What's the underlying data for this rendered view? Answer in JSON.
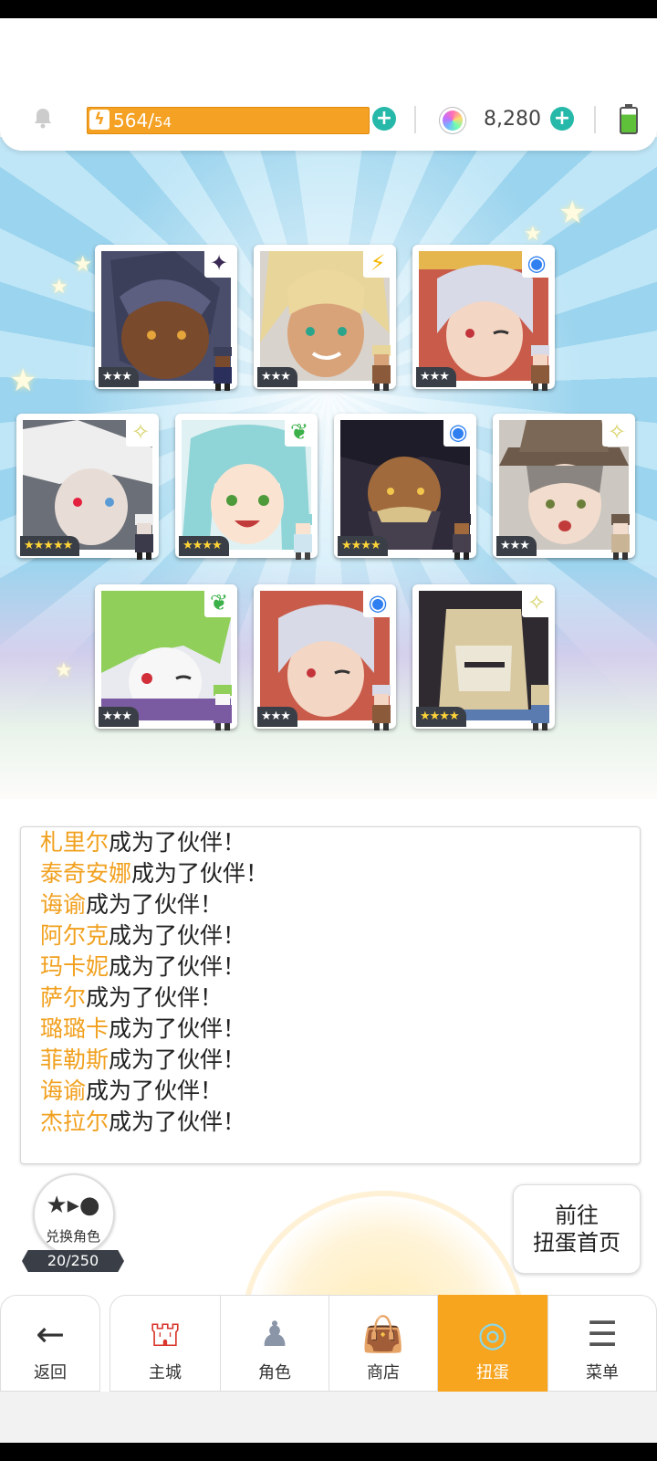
{
  "status": {
    "energy_current": "564",
    "energy_max": "54",
    "gems": "8,280"
  },
  "cards": [
    {
      "element": "dark",
      "element_icon": "✦",
      "element_color": "#3a2a55",
      "rarity": "★★★",
      "gold": false
    },
    {
      "element": "thunder",
      "element_icon": "⚡",
      "element_color": "#f5b800",
      "rarity": "★★★",
      "gold": false
    },
    {
      "element": "water",
      "element_icon": "◉",
      "element_color": "#2f7ff0",
      "rarity": "★★★",
      "gold": false
    },
    {
      "element": "light",
      "element_icon": "✧",
      "element_color": "#d7d36a",
      "rarity": "★★★★★",
      "gold": true
    },
    {
      "element": "earth",
      "element_icon": "❦",
      "element_color": "#3cb14a",
      "rarity": "★★★★",
      "gold": true
    },
    {
      "element": "water",
      "element_icon": "◉",
      "element_color": "#2f7ff0",
      "rarity": "★★★★",
      "gold": true
    },
    {
      "element": "light",
      "element_icon": "✧",
      "element_color": "#d7d36a",
      "rarity": "★★★",
      "gold": false
    },
    {
      "element": "earth",
      "element_icon": "❦",
      "element_color": "#3cb14a",
      "rarity": "★★★",
      "gold": false
    },
    {
      "element": "water",
      "element_icon": "◉",
      "element_color": "#2f7ff0",
      "rarity": "★★★",
      "gold": false
    },
    {
      "element": "light",
      "element_icon": "✧",
      "element_color": "#d7d36a",
      "rarity": "★★★★",
      "gold": true
    }
  ],
  "log": {
    "suffix": "成为了伙伴！",
    "names": [
      "札里尔",
      "泰奇安娜",
      "诲谕",
      "阿尔克",
      "玛卡妮",
      "萨尔",
      "璐璐卡",
      "菲勒斯",
      "诲谕",
      "杰拉尔"
    ]
  },
  "exchange": {
    "label": "兑换角色",
    "count": "20/250"
  },
  "goto_gacha": {
    "line1": "前往",
    "line2": "扭蛋首页"
  },
  "nav": {
    "back": "返回",
    "town": "主城",
    "characters": "角色",
    "shop": "商店",
    "gacha": "扭蛋",
    "menu": "菜单"
  },
  "colors": {
    "accent": "#f7a41f",
    "plus": "#26b8a8",
    "name_highlight": "#f1a01e"
  }
}
